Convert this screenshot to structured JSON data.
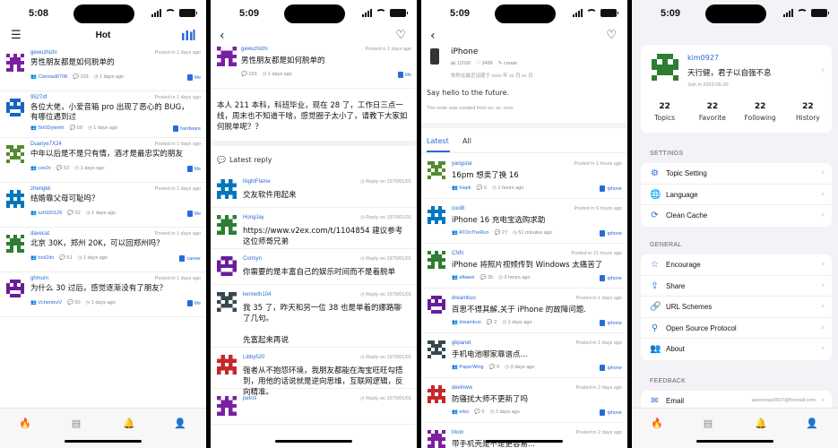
{
  "time1": "5:08",
  "time2": "5:09",
  "time3": "5:09",
  "time4": "5:09",
  "hot": {
    "title": "Hot",
    "topics": [
      {
        "user": "gewuzhizhi",
        "posted": "Posted in 1 days ago",
        "title": "男性朋友都是如何脱单的",
        "author": "Clannad0708",
        "replies": "103",
        "time": "1 days ago",
        "node": "life"
      },
      {
        "user": "9527df",
        "posted": "Posted in 1 days ago",
        "title": "各位大佬，小爱音箱 pro 出现了恶心的 BUG，有哪位遇到过",
        "author": "Str0Dytemh",
        "replies": "59",
        "time": "1 days ago",
        "node": "hardware"
      },
      {
        "user": "Duanye7X24",
        "posted": "Posted in 1 days ago",
        "title": "中年以后是不是只有情，酒才是最忠实的朋友",
        "author": "cxe2v",
        "replies": "53",
        "time": "1 days ago",
        "node": "life"
      },
      {
        "user": "zhengkk",
        "posted": "Posted in 1 days ago",
        "title": "结婚靠父母可耻吗？",
        "author": "xzh920126",
        "replies": "52",
        "time": "1 days ago",
        "node": "life"
      },
      {
        "user": "davecat",
        "posted": "Posted in 1 days ago",
        "title": "北京 30K，郑州 20K，可以回郑州吗？",
        "author": "tool2dx",
        "replies": "51",
        "time": "1 days ago",
        "node": "career"
      },
      {
        "user": "ghmum",
        "posted": "Posted in 1 days ago",
        "title": "为什么 30 过后，感觉逐渐没有了朋友？",
        "author": "VchentozV",
        "replies": "50",
        "time": "1 days ago",
        "node": "life"
      }
    ]
  },
  "detail": {
    "user": "gewuzhizhi",
    "posted": "Posted in 1 days ago",
    "title": "男性朋友都是如何脱单的",
    "replies": "103",
    "time": "1 days ago",
    "node": "life",
    "body": "本人 211 本科，科班毕业，现在 28 了，工作日三点一线，周末也不知道干啥，感觉圈子太小了，请教下大家如何脱单呢？？",
    "latest_reply_label": "Latest reply",
    "replies_list": [
      {
        "user": "NightFlame",
        "meta": "Reply on 1970/01/01",
        "text": "交友软件用起来"
      },
      {
        "user": "HongJay",
        "meta": "Reply on 1970/01/01",
        "text": "https://www.v2ex.com/t/1104854 建议参考这位师哥兄弟"
      },
      {
        "user": "Cormyn",
        "meta": "Reply on 1970/01/01",
        "text": "你需要的是丰富自己的娱乐时间而不是着脱单"
      },
      {
        "user": "kenneth104",
        "meta": "Reply on 1970/01/01",
        "text": "我 35 了，昨天和另一位 38 也是单着的娜路聊了几句。\n\n先富起来再说"
      },
      {
        "user": "Libby520",
        "meta": "Reply on 1970/01/01",
        "text": "强者从不抱怨环境，我朋友都能在淘宝旺旺勾搭到，用他的话说就是逆向思维，互联网逻辑，反向精准。"
      },
      {
        "user": "petrol",
        "meta": "Reply on 1970/01/01",
        "text": ""
      }
    ]
  },
  "node": {
    "name": "iPhone",
    "topics_count": "12030",
    "stars": "3468",
    "create": "create",
    "desc_line": "你所在最近话题于 xxxx 年 xx 月 xx 日",
    "slogan": "Say hello to the future.",
    "created_note": "The node was created from xx, xx, xxxx",
    "tab_latest": "Latest",
    "tab_all": "All",
    "topics": [
      {
        "user": "yangstar",
        "posted": "Posted in 1 hours ago",
        "title": "16pm 想卖了换 16",
        "author": "hiapk",
        "replies": "6",
        "time": "1 hours ago",
        "node": "iphone"
      },
      {
        "user": "cool8",
        "posted": "Posted in 6 hours ago",
        "title": "iPhone 16 充电宝选购求助",
        "author": "ATOnTheRun",
        "replies": "27",
        "time": "51 minutes ago",
        "node": "iphone"
      },
      {
        "user": "CNN",
        "posted": "Posted in 21 hours ago",
        "title": "iPhone 将照片视频传到 Windows 太痛苦了",
        "author": "alfawel",
        "replies": "35",
        "time": "3 hours ago",
        "node": "iphone"
      },
      {
        "user": "dreamkuo",
        "posted": "Posted in 1 days ago",
        "title": "百思不得其解,关于 iPhone 的故障问题.",
        "author": "dreamkuo",
        "replies": "2",
        "time": "1 days ago",
        "node": "iphone"
      },
      {
        "user": "gkpanet",
        "posted": "Posted in 1 days ago",
        "title": "手机电池哪家靠谱点...",
        "author": "PaperWing",
        "replies": "9",
        "time": "3 days ago",
        "node": "iphone"
      },
      {
        "user": "devinww",
        "posted": "Posted in 2 days ago",
        "title": "防骚扰大师不更新了吗",
        "author": "erko",
        "replies": "5",
        "time": "2 days ago",
        "node": "iphone"
      },
      {
        "user": "trkon",
        "posted": "Posted in 2 days ago",
        "title": "带手机壳是不是更容易...",
        "author": "",
        "replies": "",
        "time": "",
        "node": ""
      }
    ]
  },
  "profile": {
    "username": "kim0927",
    "motto": "天行健，君子以自强不息",
    "joined": "Join in 2023-05-20",
    "stats": [
      {
        "value": "22",
        "label": "Topics"
      },
      {
        "value": "22",
        "label": "Favorite"
      },
      {
        "value": "22",
        "label": "Following"
      },
      {
        "value": "22",
        "label": "History"
      }
    ],
    "settings_label": "SETTINGS",
    "settings": [
      "Topic Setting",
      "Language",
      "Clean Cache"
    ],
    "general_label": "GENERAL",
    "general": [
      "Encourage",
      "Share",
      "URL Schemes",
      "Open Source Protocol",
      "About"
    ],
    "feedback_label": "FEEDBACK",
    "email_label": "Email",
    "email_value": "aaronxiao0927@foxmail.com"
  },
  "colors": {
    "accent": "#2a6bd7",
    "tab_active": "#2a6bd7",
    "settings_bg": "#f2f2f7"
  }
}
